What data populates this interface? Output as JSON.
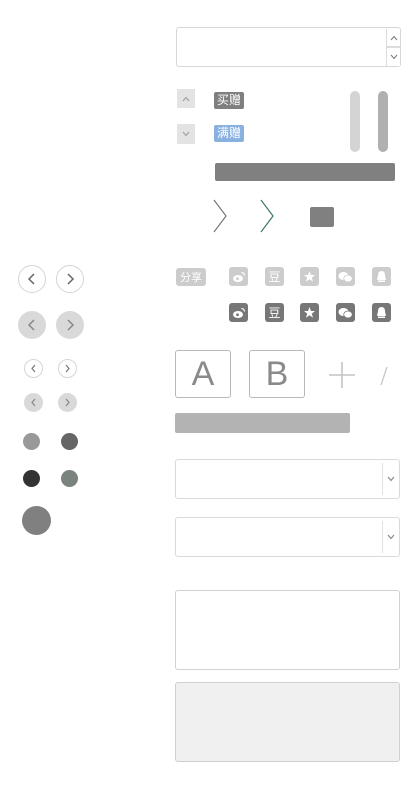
{
  "spinner": {
    "value": ""
  },
  "gifts": {
    "buy_gift": "买赠",
    "full_gift": "满赠"
  },
  "share": {
    "label": "分享",
    "douban_char": "豆"
  },
  "letters": {
    "a": "A",
    "b": "B",
    "plus": "+",
    "slash": "/"
  },
  "selects": [
    {
      "value": ""
    },
    {
      "value": ""
    }
  ],
  "textareas": [
    {
      "value": ""
    },
    {
      "value": ""
    }
  ],
  "colors": {
    "gift_buy": "#7f7f7f",
    "gift_full": "#8ab0e0",
    "share_light": "#cccccc",
    "share_dark": "#777777",
    "dot_light": "#999999",
    "dot_mid": "#666666",
    "dot_dark": "#333333",
    "dot_green_gray": "#7a837e",
    "dot_big": "#808080",
    "bar_dark": "#808080",
    "bar_light": "#b3b3b3",
    "chevron_green": "#3d7a5e"
  }
}
